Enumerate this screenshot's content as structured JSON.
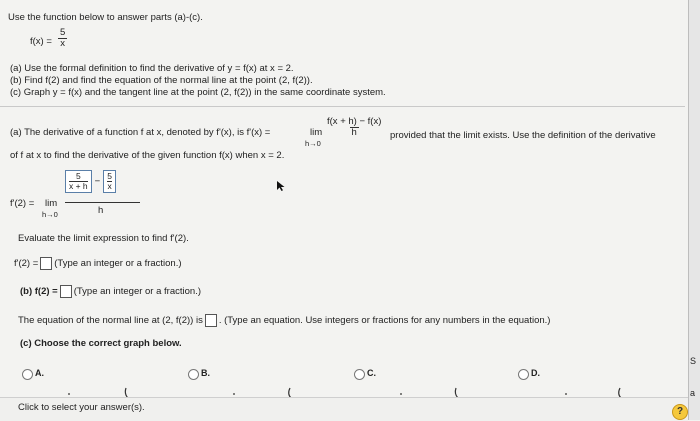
{
  "problem": {
    "intro": "Use the function below to answer parts (a)-(c).",
    "func_lhs": "f(x) =",
    "func_num": "5",
    "func_den": "x",
    "part_a": "(a) Use the formal definition to find the derivative of y = f(x) at x = 2.",
    "part_b": "(b) Find f(2) and find the equation of the normal line at the point (2, f(2)).",
    "part_c": "(c) Graph y = f(x) and the tangent line at the point (2, f(2)) in the same coordinate system."
  },
  "definition": {
    "lead": "(a) The derivative of a function f at x, denoted by f'(x), is f'(x) =",
    "lim": "lim",
    "lim_sub": "h→0",
    "frac_num": "f(x + h) − f(x)",
    "frac_den": "h",
    "trail": "provided that the limit exists. Use the definition of the derivative",
    "line2": "of f at x to find the derivative of the given function f(x) when x = 2."
  },
  "limit_expr": {
    "lhs": "f'(2) =",
    "lim": "lim",
    "lim_sub": "h→0",
    "t1_num": "5",
    "t1_den": "x + h",
    "minus": "−",
    "t2_num": "5",
    "t2_den": "x",
    "outer_den": "h"
  },
  "evaluate_text": "Evaluate the limit expression to find f'(2).",
  "answer_a": {
    "lhs": "f'(2) =",
    "hint": "(Type an integer or a fraction.)"
  },
  "answer_b": {
    "lhs": "(b) f(2) =",
    "hint": "(Type an integer or a fraction.)"
  },
  "normal_line": {
    "lead": "The equation of the normal line at (2, f(2)) is",
    "hint": ". (Type an equation. Use integers or fractions for any numbers in the equation.)"
  },
  "part_c_prompt": "(c) Choose the correct graph below.",
  "options": [
    {
      "label": "A."
    },
    {
      "label": "B."
    },
    {
      "label": "C."
    },
    {
      "label": "D."
    }
  ],
  "footer": {
    "status": "Click to select your answer(s).",
    "help": "?"
  },
  "right_edge": {
    "s": "S",
    "a": "a"
  }
}
